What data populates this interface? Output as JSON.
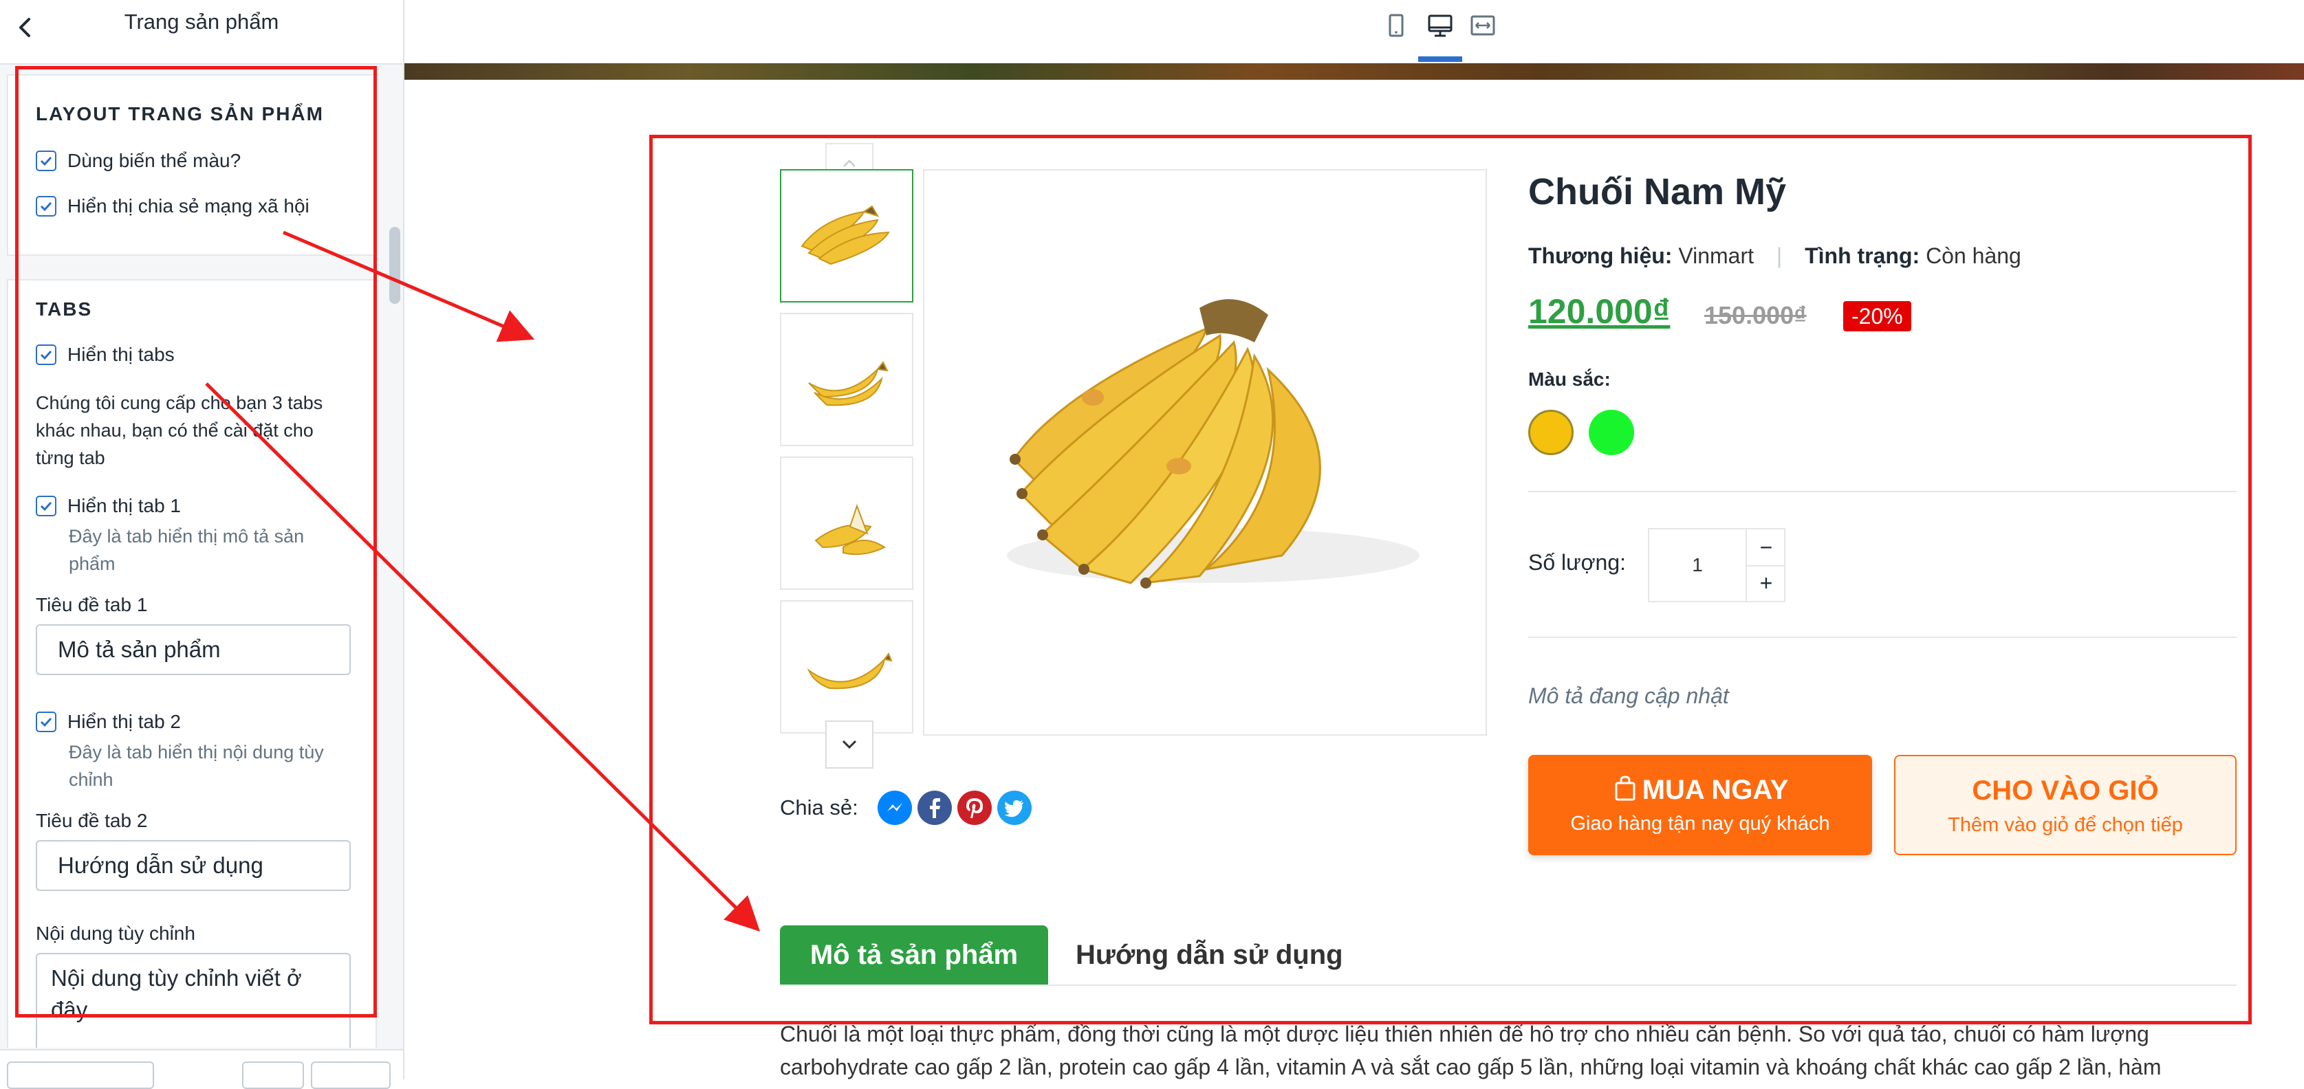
{
  "panel": {
    "title": "Trang sản phẩm",
    "section_layout": {
      "title": "LAYOUT TRANG SẢN PHẨM",
      "use_color_variant": "Dùng biến thể màu?",
      "show_social_share": "Hiển thị chia sẻ mạng xã hội"
    },
    "section_tabs": {
      "title": "TABS",
      "show_tabs": "Hiển thị tabs",
      "description": "Chúng tôi cung cấp cho bạn 3 tabs khác nhau, bạn có thể cài đặt cho từng tab",
      "show_tab1": "Hiển thị tab 1",
      "tab1_help": "Đây là tab hiển thị mô tả sản phẩm",
      "tab1_title_label": "Tiêu đề tab 1",
      "tab1_title_value": "Mô tả sản phẩm",
      "show_tab2": "Hiển thị tab 2",
      "tab2_help": "Đây là tab hiển thị nội dung tùy chỉnh",
      "tab2_title_label": "Tiêu đề tab 2",
      "tab2_title_value": "Hướng dẫn sử dụng",
      "custom_content_label": "Nội dung tùy chỉnh",
      "custom_content_value": "Nội dung tùy chỉnh viết ở đây"
    }
  },
  "toolbar": {
    "devices": [
      "mobile-icon",
      "desktop-icon",
      "fullwidth-icon"
    ],
    "active_device": "desktop-icon"
  },
  "product": {
    "name": "Chuối Nam Mỹ",
    "brand_label": "Thương hiệu:",
    "brand_value": "Vinmart",
    "status_label": "Tình trạng:",
    "status_value": "Còn hàng",
    "price": "120.000₫",
    "old_price": "150.000₫",
    "discount": "-20%",
    "color_label": "Màu sắc:",
    "colors": [
      "#f5c10c",
      "#19f52c"
    ],
    "quantity_label": "Số lượng:",
    "quantity": "1",
    "qty_minus": "−",
    "qty_plus": "+",
    "short_description": "Mô tả đang cập nhật",
    "buy_now": "MUA NGAY",
    "buy_now_sub": "Giao hàng tận nay quý khách",
    "add_to_cart": "CHO VÀO GIỎ",
    "add_to_cart_sub": "Thêm vào giỏ để chọn tiếp",
    "share_label": "Chia sẻ:",
    "share_icons": [
      "messenger-icon",
      "facebook-icon",
      "pinterest-icon",
      "twitter-icon"
    ],
    "tabs": [
      "Mô tả sản phẩm",
      "Hướng dẫn sử dụng"
    ],
    "description": "Chuối là một loại thực phẩm, đồng thời cũng là một dược liệu thiên nhiên để hỗ trợ cho nhiều căn bệnh. So với quả táo, chuối có hàm lượng carbohydrate cao gấp 2 lần, protein cao gấp 4 lần, vitamin A và sắt cao gấp 5 lần, những loại vitamin và khoáng chất khác cao gấp 2 lần, hàm"
  },
  "colors": {
    "accent_green": "#2ea043",
    "accent_orange": "#fe6b0f",
    "annotation_red": "#ee1c1c",
    "checkbox_blue": "#2c6ecb"
  }
}
